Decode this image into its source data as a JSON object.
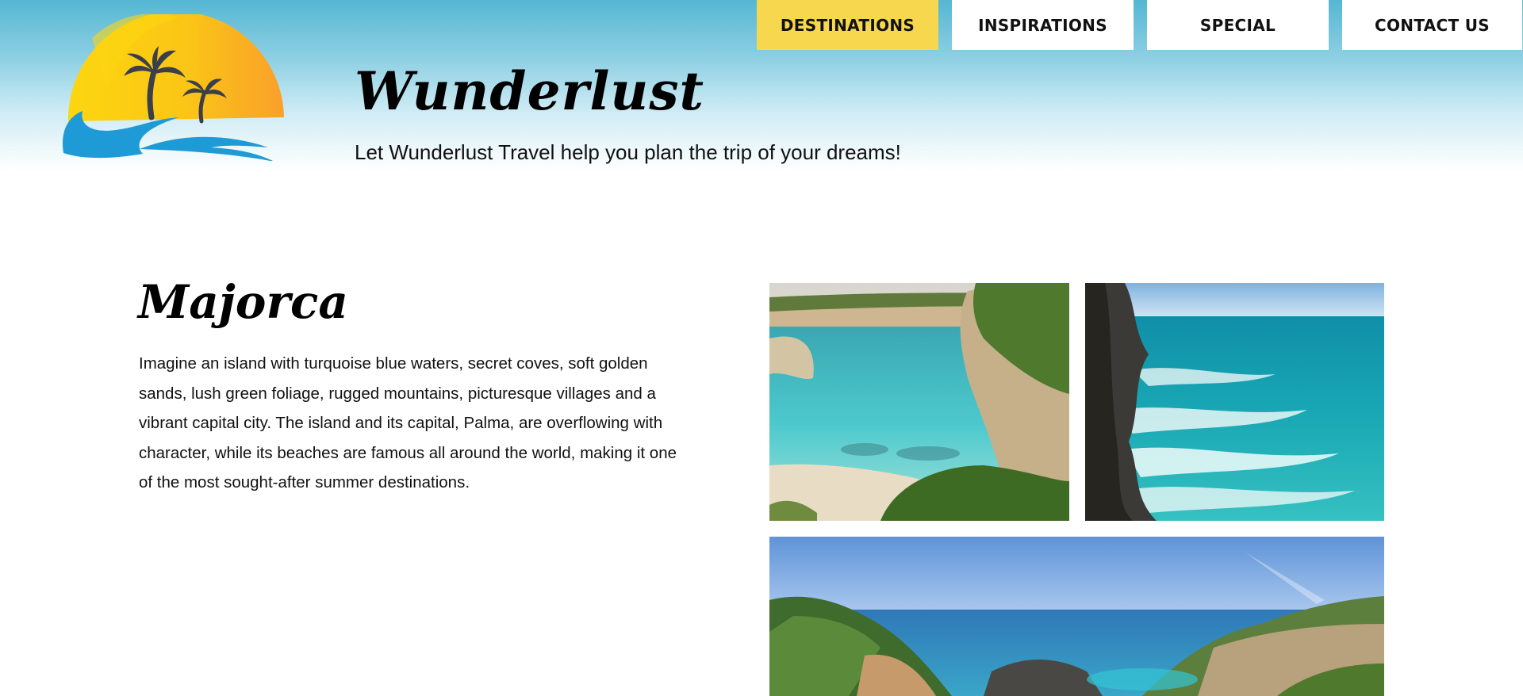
{
  "header": {
    "logo_icon": "palm-sunset-logo-icon",
    "title": "Wunderlust",
    "tagline": "Let Wunderlust Travel help you plan the trip of your dreams!"
  },
  "nav": {
    "items": [
      {
        "label": "DESTINATIONS",
        "active": true
      },
      {
        "label": "INSPIRATIONS",
        "active": false
      },
      {
        "label": "SPECIAL",
        "active": false
      },
      {
        "label": "CONTACT US",
        "active": false
      }
    ]
  },
  "main": {
    "title": "Majorca",
    "body": "Imagine an island with turquoise blue waters, secret coves, soft golden sands, lush green foliage, rugged mountains, picturesque villages and a vibrant capital city. The island and its capital, Palma, are overflowing with character, while its beaches are famous all around the world, making it one of the most sought-after summer destinations."
  },
  "colors": {
    "active_nav": "#f7d74e",
    "header_top": "#55b7d3",
    "sun_yellow": "#fcd610",
    "sun_orange": "#f9a72b",
    "wave_blue": "#1e9bd7",
    "palm": "#3a3f4a"
  }
}
